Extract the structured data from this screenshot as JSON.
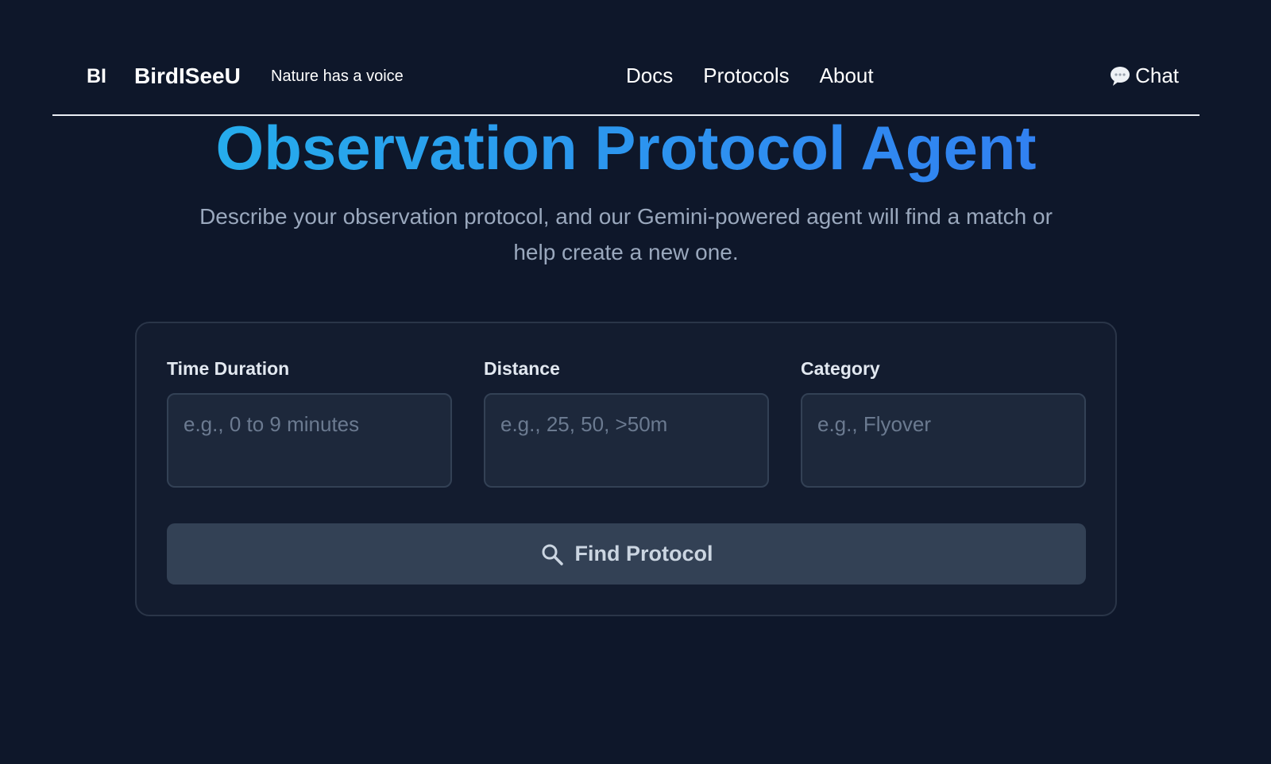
{
  "header": {
    "logo_mark": "BI",
    "brand_name": "BirdISeeU",
    "tagline": "Nature has a voice",
    "nav": [
      {
        "label": "Docs"
      },
      {
        "label": "Protocols"
      },
      {
        "label": "About"
      }
    ],
    "chat_label": "Chat",
    "chat_icon": "speech-bubble-icon"
  },
  "hero": {
    "title": "Observation Protocol Agent",
    "subtitle": "Describe your observation protocol, and our Gemini-powered agent will find a match or help create a new one."
  },
  "form": {
    "fields": [
      {
        "label": "Time Duration",
        "value": "",
        "placeholder": "e.g., 0 to 9 minutes"
      },
      {
        "label": "Distance",
        "value": "",
        "placeholder": "e.g., 25, 50, >50m"
      },
      {
        "label": "Category",
        "value": "",
        "placeholder": "e.g., Flyover"
      }
    ],
    "submit_label": "Find Protocol",
    "submit_icon": "search-icon"
  },
  "colors": {
    "background": "#0e172a",
    "card": "#131c2f",
    "input": "#1d283b",
    "button": "#334155",
    "title_gradient_start": "#22b8ea",
    "title_gradient_end": "#3377f2",
    "subtitle": "#9aa8bd"
  }
}
